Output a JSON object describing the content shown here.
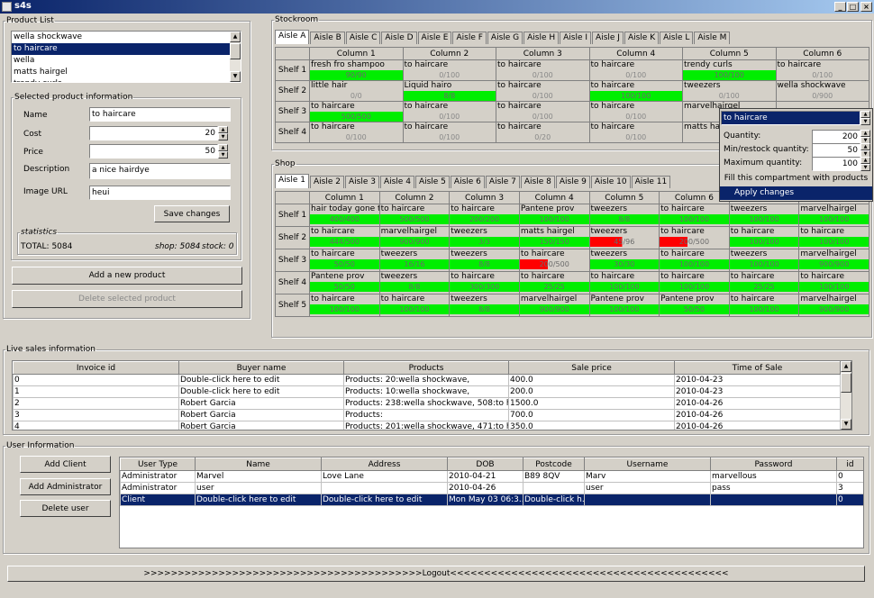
{
  "window": {
    "title": "s4s",
    "min": "_",
    "max": "□",
    "close": "×"
  },
  "product_list": {
    "legend": "Product List",
    "items": [
      "wella shockwave",
      "to haircare",
      "wella",
      "matts hairgel",
      "trendy curls"
    ],
    "selected": 1
  },
  "selected_info": {
    "legend": "Selected product information",
    "name_label": "Name",
    "name_value": "to haircare",
    "cost_label": "Cost",
    "cost_value": "20",
    "price_label": "Price",
    "price_value": "50",
    "desc_label": "Description",
    "desc_value": "a nice hairdye",
    "url_label": "Image URL",
    "url_value": "heui",
    "save": "Save changes",
    "stats_legend": "statistics",
    "total": "TOTAL:  5084",
    "shop": "shop:  5084",
    "stock": "stock:  0"
  },
  "add_product": "Add a new product",
  "delete_product": "Delete selected product",
  "stockroom": {
    "legend": "Stockroom",
    "tabs": [
      "Aisle A",
      "Aisle B",
      "Aisle C",
      "Aisle D",
      "Aisle E",
      "Aisle F",
      "Aisle G",
      "Aisle H",
      "Aisle I",
      "Aisle J",
      "Aisle K",
      "Aisle L",
      "Aisle M"
    ],
    "selected_tab": 0,
    "columns": [
      "Column 1",
      "Column 2",
      "Column 3",
      "Column 4",
      "Column 5",
      "Column 6"
    ],
    "rows": [
      {
        "label": "Shelf 1",
        "cells": [
          [
            "fresh fro shampoo",
            "90/90",
            "g"
          ],
          [
            "to haircare",
            "0/100",
            ""
          ],
          [
            "to haircare",
            "0/100",
            ""
          ],
          [
            "to haircare",
            "0/100",
            ""
          ],
          [
            "trendy curls",
            "100/100",
            "g"
          ],
          [
            "to haircare",
            "0/100",
            ""
          ]
        ]
      },
      {
        "label": "Shelf 2",
        "cells": [
          [
            "little hair",
            "0/0",
            ""
          ],
          [
            "Liquid hairo",
            "8/8",
            "g"
          ],
          [
            "to haircare",
            "0/100",
            ""
          ],
          [
            "to haircare",
            "100/100",
            "g"
          ],
          [
            "tweezers",
            "0/100",
            ""
          ],
          [
            "wella shockwave",
            "0/900",
            ""
          ]
        ]
      },
      {
        "label": "Shelf 3",
        "cells": [
          [
            "to haircare",
            "500/500",
            "g"
          ],
          [
            "to haircare",
            "0/100",
            ""
          ],
          [
            "to haircare",
            "0/100",
            ""
          ],
          [
            "to haircare",
            "0/100",
            ""
          ],
          [
            "marvelhairgel",
            "",
            ""
          ],
          [
            "",
            "",
            ""
          ]
        ]
      },
      {
        "label": "Shelf 4",
        "cells": [
          [
            "to haircare",
            "0/100",
            ""
          ],
          [
            "to haircare",
            "0/100",
            ""
          ],
          [
            "to haircare",
            "0/20",
            ""
          ],
          [
            "to haircare",
            "0/100",
            ""
          ],
          [
            "matts hairgel",
            "",
            ""
          ],
          [
            "",
            "",
            ""
          ]
        ]
      }
    ]
  },
  "shop": {
    "legend": "Shop",
    "tabs": [
      "Aisle 1",
      "Aisle 2",
      "Aisle 3",
      "Aisle 4",
      "Aisle 5",
      "Aisle 6",
      "Aisle 7",
      "Aisle 8",
      "Aisle 9",
      "Aisle 10",
      "Aisle 11"
    ],
    "selected_tab": 0,
    "columns": [
      "Column 1",
      "Column 2",
      "Column 3",
      "Column 4",
      "Column 5",
      "Column 6",
      "",
      ""
    ],
    "rows": [
      {
        "label": "Shelf 1",
        "cells": [
          [
            "hair today gone to",
            "400/400",
            "g"
          ],
          [
            "to haircare",
            "500/500",
            "g"
          ],
          [
            "to haircare",
            "200/200",
            "g"
          ],
          [
            "Pantene prov",
            "100/100",
            "g"
          ],
          [
            "tweezers",
            "8/8",
            "g"
          ],
          [
            "to haircare",
            "100/100",
            "g"
          ],
          [
            "tweezers",
            "100/100",
            "g"
          ],
          [
            "marvelhairgel",
            "100/100",
            "g"
          ]
        ]
      },
      {
        "label": "Shelf 2",
        "cells": [
          [
            "to haircare",
            "444/500",
            "g"
          ],
          [
            "marvelhairgel",
            "900/900",
            "g"
          ],
          [
            "tweezers",
            "3/3",
            "g"
          ],
          [
            "matts hairgel",
            "150/150",
            "g"
          ],
          [
            "tweezers",
            "45/96",
            "r"
          ],
          [
            "to haircare",
            "200/500",
            "r"
          ],
          [
            "to haircare",
            "100/100",
            "g"
          ],
          [
            "to haircare",
            "100/100",
            "g"
          ]
        ]
      },
      {
        "label": "Shelf 3",
        "cells": [
          [
            "to haircare",
            "50/50",
            "g"
          ],
          [
            "tweezers",
            "16/16",
            "g"
          ],
          [
            "tweezers",
            "8/8",
            "g"
          ],
          [
            "to haircare",
            "200/500",
            "r"
          ],
          [
            "tweezers",
            "30/30",
            "g"
          ],
          [
            "to haircare",
            "100/100",
            "g"
          ],
          [
            "tweezers",
            "100/100",
            "g"
          ],
          [
            "marvelhairgel",
            "900/900",
            "g"
          ]
        ]
      },
      {
        "label": "Shelf 4",
        "cells": [
          [
            "Pantene prov",
            "50/50",
            "g"
          ],
          [
            "tweezers",
            "8/8",
            "g"
          ],
          [
            "to haircare",
            "300/300",
            "g"
          ],
          [
            "to haircare",
            "25/25",
            "g"
          ],
          [
            "to haircare",
            "100/100",
            "g"
          ],
          [
            "to haircare",
            "100/100",
            "g"
          ],
          [
            "to haircare",
            "25/25",
            "g"
          ],
          [
            "to haircare",
            "100/100",
            "g"
          ]
        ]
      },
      {
        "label": "Shelf 5",
        "cells": [
          [
            "to haircare",
            "100/100",
            "g"
          ],
          [
            "to haircare",
            "100/100",
            "g"
          ],
          [
            "tweezers",
            "8/8",
            "g"
          ],
          [
            "marvelhairgel",
            "900/900",
            "g"
          ],
          [
            "Pantene prov",
            "100/100",
            "g"
          ],
          [
            "Pantene prov",
            "50/50",
            "g"
          ],
          [
            "to haircare",
            "100/100",
            "g"
          ],
          [
            "marvelhairgel",
            "900/900",
            "g"
          ]
        ]
      }
    ]
  },
  "popup": {
    "product": "to haircare",
    "quantity_label": "Quantity:",
    "quantity": "200",
    "min_label": "Min/restock quantity:",
    "min": "50",
    "max_label": "Maximum quantity:",
    "max": "100",
    "fill": "Fill this compartment with products",
    "apply": "Apply changes"
  },
  "sales": {
    "legend": "Live sales information",
    "columns": [
      "Invoice id",
      "Buyer name",
      "Products",
      "Sale price",
      "Time of Sale"
    ],
    "rows": [
      [
        "0",
        "Double-click here to edit",
        "Products: 20:wella shockwave,",
        "400.0",
        "2010-04-23"
      ],
      [
        "1",
        "Double-click here to edit",
        "Products: 10:wella shockwave,",
        "200.0",
        "2010-04-23"
      ],
      [
        "2",
        "Robert Garcia",
        "Products: 238:wella shockwave, 508:to h...",
        "1500.0",
        "2010-04-26"
      ],
      [
        "3",
        "Robert Garcia",
        "Products:",
        "700.0",
        "2010-04-26"
      ],
      [
        "4",
        "Robert Garcia",
        "Products: 201:wella shockwave, 471:to h...",
        "350.0",
        "2010-04-26"
      ]
    ]
  },
  "users": {
    "legend": "User Information",
    "add_client": "Add Client",
    "add_admin": "Add Administrator",
    "delete_user": "Delete user",
    "columns": [
      "User Type",
      "Name",
      "Address",
      "DOB",
      "Postcode",
      "Username",
      "Password",
      "id"
    ],
    "rows": [
      [
        "Administrator",
        "Marvel",
        "Love Lane",
        "2010-04-21",
        "B89 8QV",
        "Marv",
        "marvellous",
        "0"
      ],
      [
        "Administrator",
        "user",
        "",
        "2010-04-26",
        "",
        "user",
        "pass",
        "3"
      ],
      [
        "Client",
        "Double-click here to edit",
        "Double-click here to edit",
        "Mon May 03 06:3...",
        "Double-click h...",
        "",
        "",
        "0"
      ]
    ],
    "selected": 2
  },
  "logout": ">>>>>>>>>>>>>>>>>>>>>>>>>>>>>>>>>>>>>>>>>Logout<<<<<<<<<<<<<<<<<<<<<<<<<<<<<<<<<<<<<<<<<"
}
